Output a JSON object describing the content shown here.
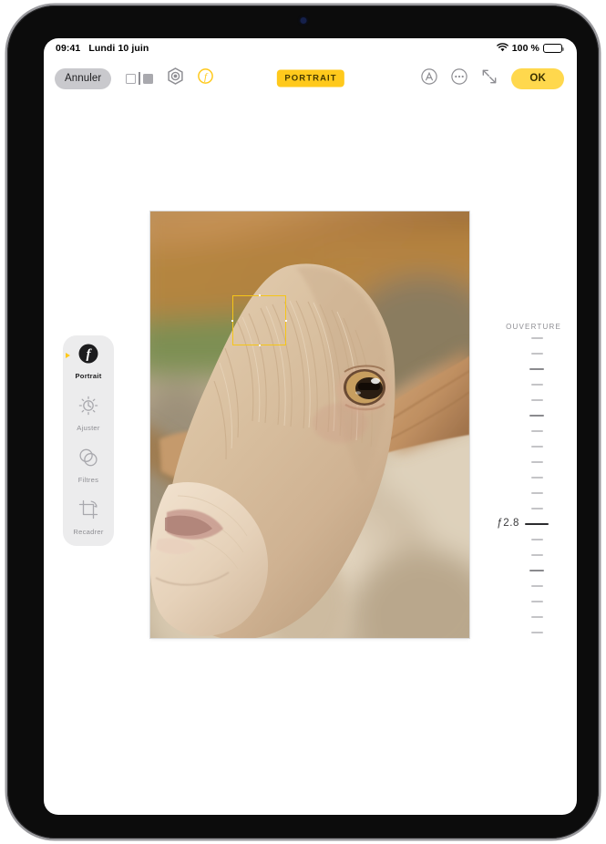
{
  "status_bar": {
    "time": "09:41",
    "date": "Lundi 10 juin",
    "battery_percent": "100 %",
    "wifi_icon": "wifi-icon",
    "battery_icon": "battery-icon"
  },
  "toolbar": {
    "cancel_label": "Annuler",
    "ok_label": "OK",
    "mode_badge": "PORTRAIT",
    "compare_icon": "compare-toggle-icon",
    "live_photo_icon": "live-photo-icon",
    "portrait_f_icon": "portrait-f-icon",
    "markup_icon": "markup-circle-a-icon",
    "more_icon": "more-options-icon",
    "expand_icon": "expand-arrows-icon"
  },
  "tools": {
    "items": [
      {
        "label": "Portrait",
        "icon": "portrait-f-icon",
        "active": true
      },
      {
        "label": "Ajuster",
        "icon": "adjust-brightness-icon",
        "active": false
      },
      {
        "label": "Filtres",
        "icon": "filters-circles-icon",
        "active": false
      },
      {
        "label": "Recadrer",
        "icon": "crop-icon",
        "active": false
      }
    ]
  },
  "aperture": {
    "title": "OUVERTURE",
    "value": "ƒ2.8",
    "current_index": 12,
    "ticks": [
      "minor",
      "minor",
      "major",
      "minor",
      "minor",
      "major",
      "minor",
      "minor",
      "minor",
      "minor",
      "minor",
      "minor",
      "current",
      "minor",
      "minor",
      "major",
      "minor",
      "minor",
      "minor",
      "minor"
    ]
  },
  "photo": {
    "subject": "goat-close-up",
    "focus_square": "focus-rectangle",
    "focus_color": "#f5c518"
  },
  "colors": {
    "accent_yellow": "#ffc91c",
    "ok_yellow": "#ffd84d",
    "rail_bg": "#ececed",
    "cancel_gray": "#c9c9cd"
  }
}
